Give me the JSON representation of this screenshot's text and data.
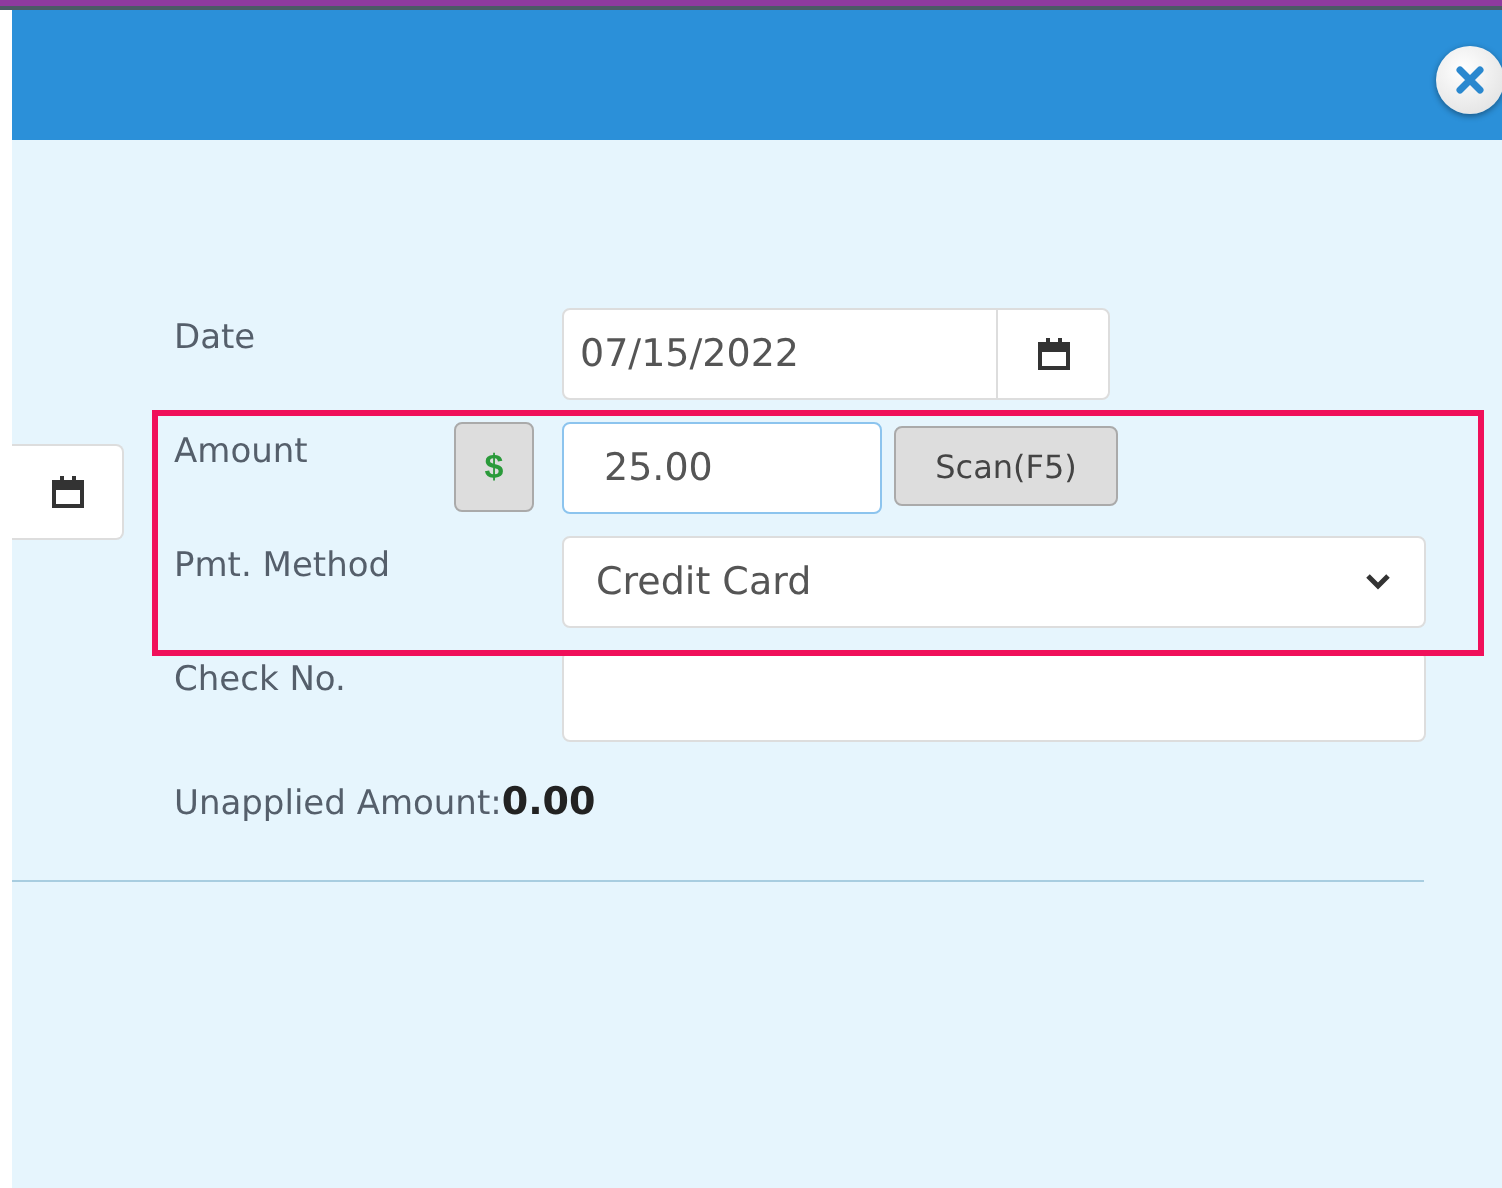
{
  "fields": [
    {
      "kind": "date",
      "label": "Date",
      "value": "07/15/2022"
    },
    {
      "kind": "amount",
      "label": "Amount",
      "prefix": "$",
      "value": "25.00",
      "focused": true,
      "button": "Scan(F5)"
    },
    {
      "kind": "select",
      "label": "Pmt. Method",
      "value": "Credit Card"
    },
    {
      "kind": "text",
      "label": "Check No."
    }
  ],
  "summary": {
    "label": "Unapplied Amount:",
    "value": "0.00"
  },
  "highlight": {
    "shown": true
  }
}
